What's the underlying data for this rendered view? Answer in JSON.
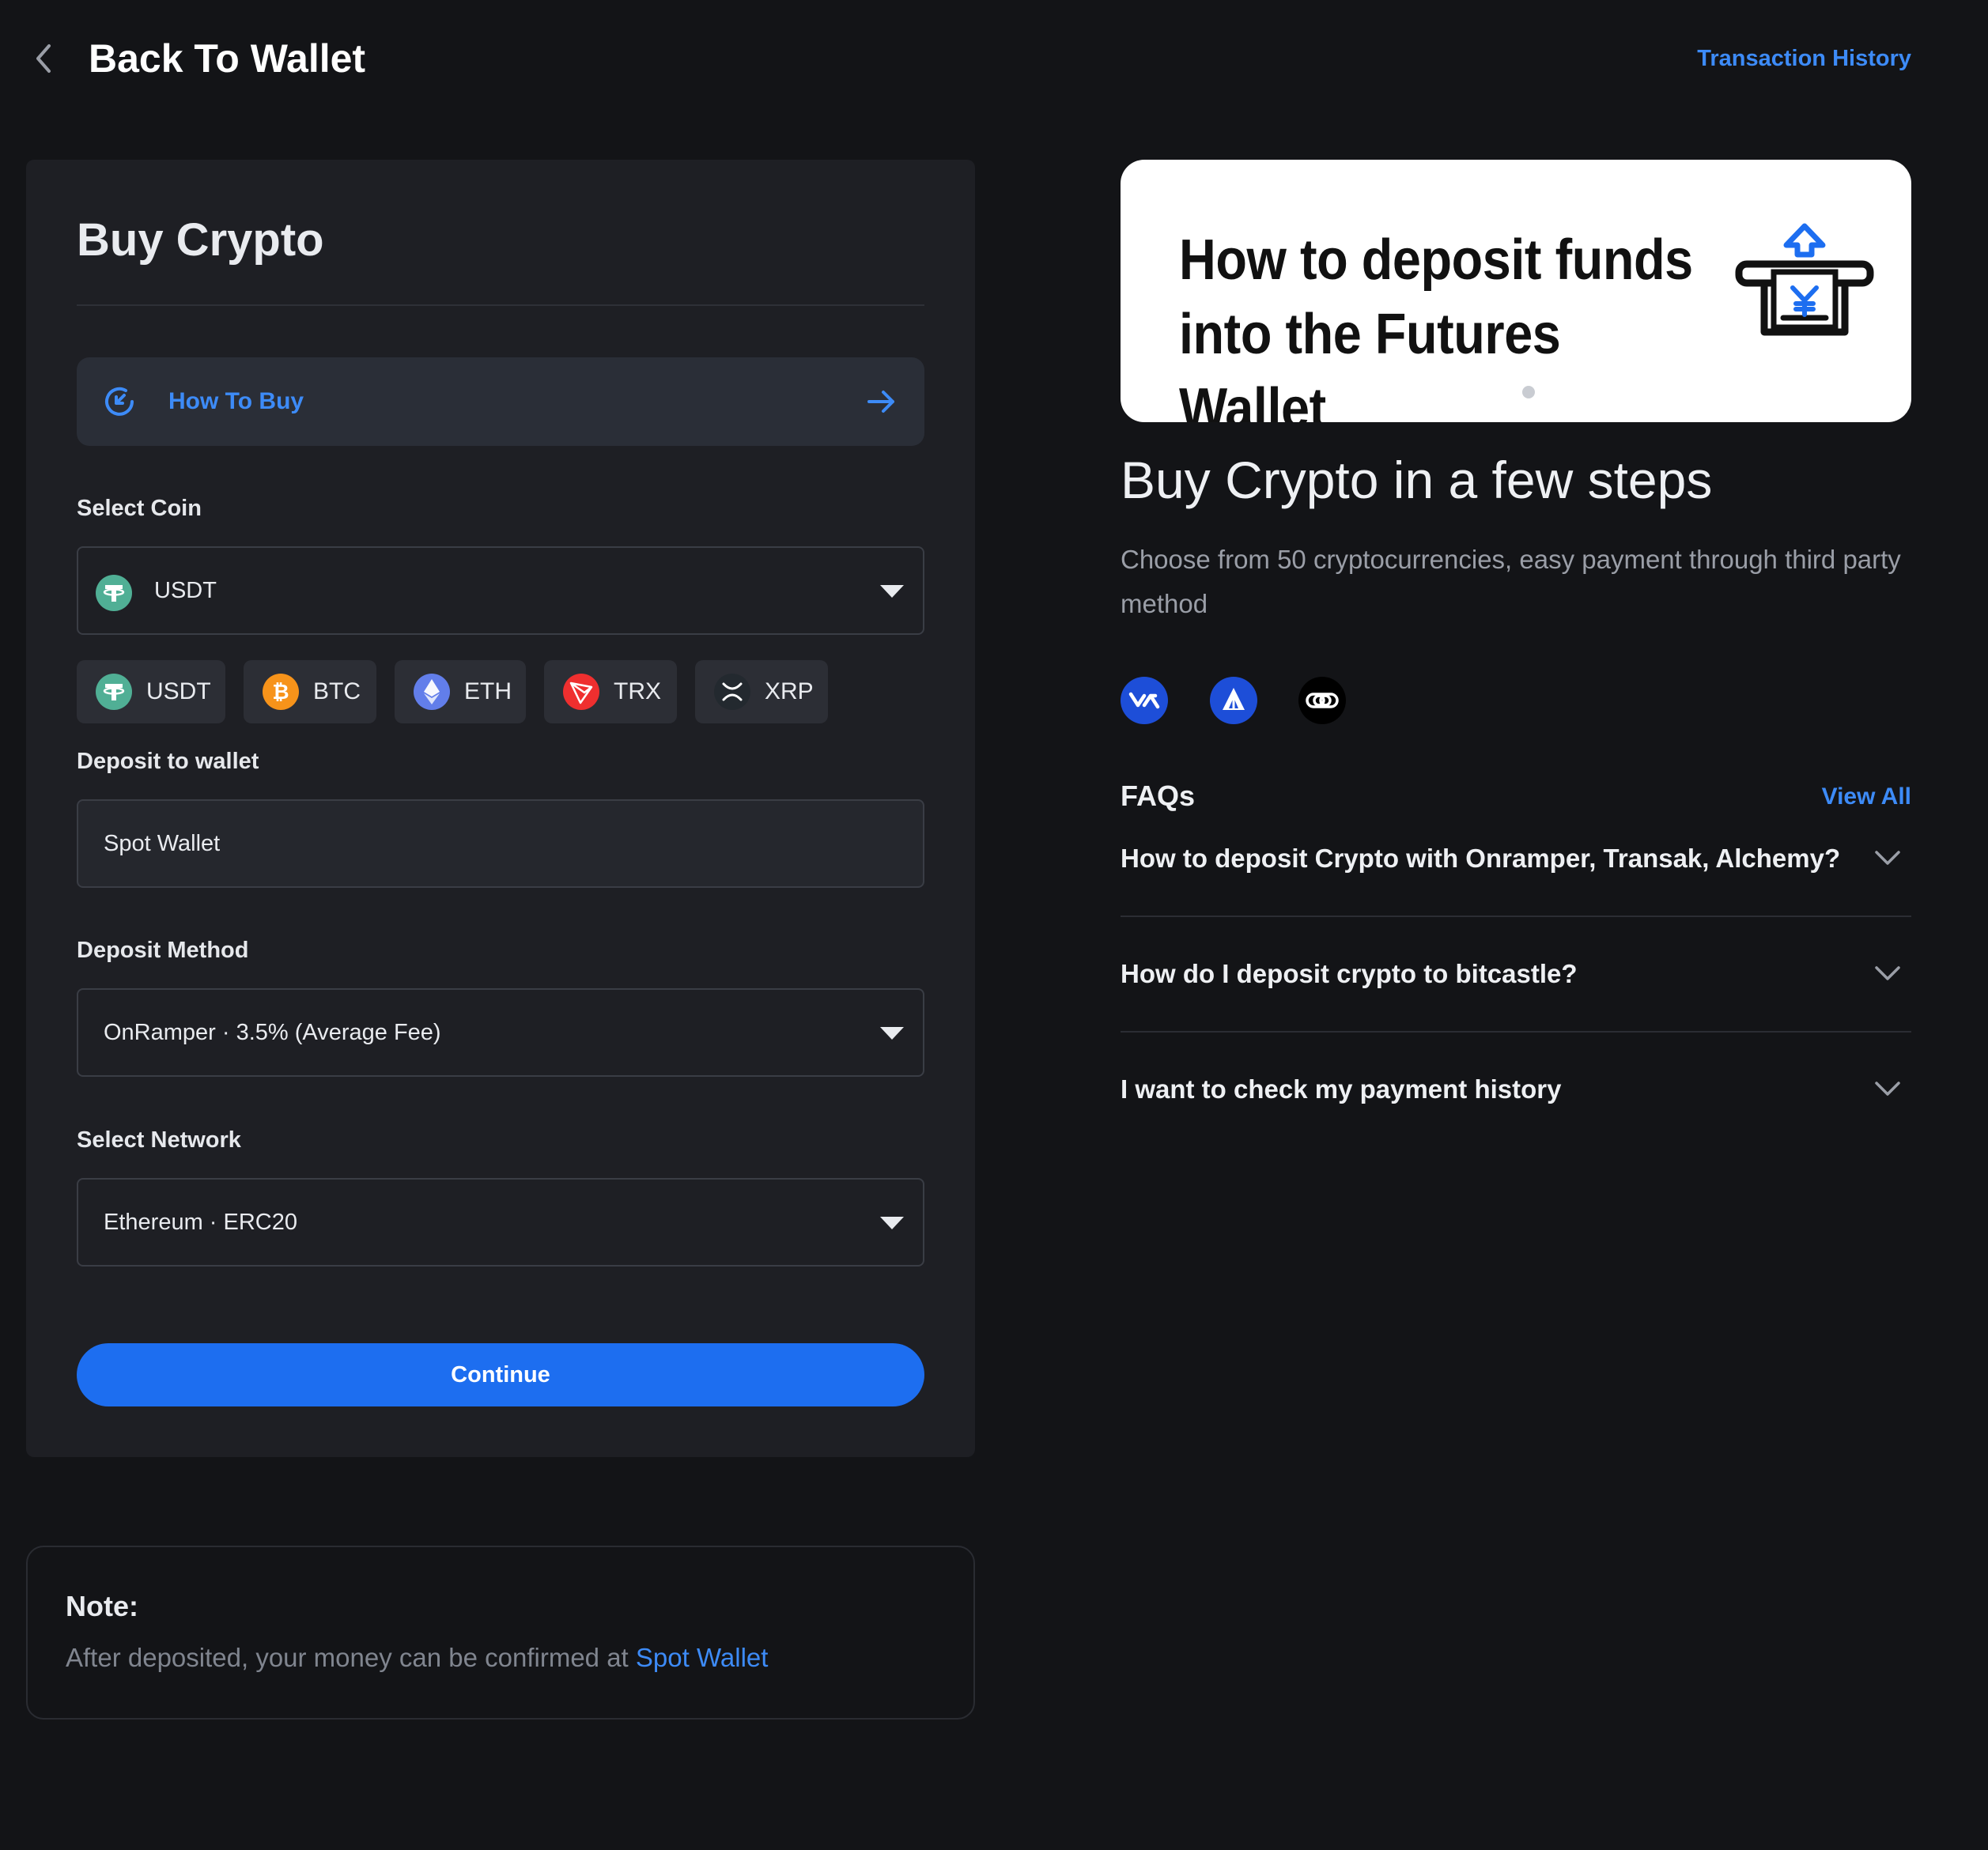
{
  "header": {
    "back_label": "Back To Wallet",
    "transaction_history": "Transaction History"
  },
  "buy": {
    "title": "Buy Crypto",
    "how_to_buy": "How To Buy",
    "select_coin_label": "Select Coin",
    "selected_coin": "USDT",
    "coins": [
      {
        "symbol": "USDT",
        "icon": "usdt-icon",
        "color": "#50af95"
      },
      {
        "symbol": "BTC",
        "icon": "btc-icon",
        "color": "#f7931a"
      },
      {
        "symbol": "ETH",
        "icon": "eth-icon",
        "color": "#627eea"
      },
      {
        "symbol": "TRX",
        "icon": "trx-icon",
        "color": "#ef2f2f"
      },
      {
        "symbol": "XRP",
        "icon": "xrp-icon",
        "color": "#23292f"
      }
    ],
    "deposit_wallet_label": "Deposit to wallet",
    "deposit_wallet_value": "Spot Wallet",
    "deposit_method_label": "Deposit Method",
    "deposit_method_value": "OnRamper · 3.5% (Average Fee)",
    "network_label": "Select Network",
    "network_value": "Ethereum · ERC20",
    "continue": "Continue"
  },
  "note": {
    "title": "Note:",
    "text": "After deposited, your money can be confirmed at ",
    "link": "Spot Wallet"
  },
  "right": {
    "banner_text": "How to deposit funds into the Futures Wallet",
    "steps_title": "Buy Crypto in a few steps",
    "steps_subtitle": "Choose from 50 cryptocurrencies, easy payment through third party method",
    "providers": [
      "onramper-icon",
      "alchemy-icon",
      "transak-icon"
    ],
    "faq_title": "FAQs",
    "view_all": "View All",
    "faqs": [
      "How to deposit Crypto with Onramper, Transak, Alchemy?",
      "How do I deposit crypto to bitcastle?",
      "I want to check my payment history"
    ]
  },
  "colors": {
    "accent": "#3d8bf7",
    "button": "#1d6ef0",
    "background": "#131417",
    "card": "#1e1f24"
  }
}
